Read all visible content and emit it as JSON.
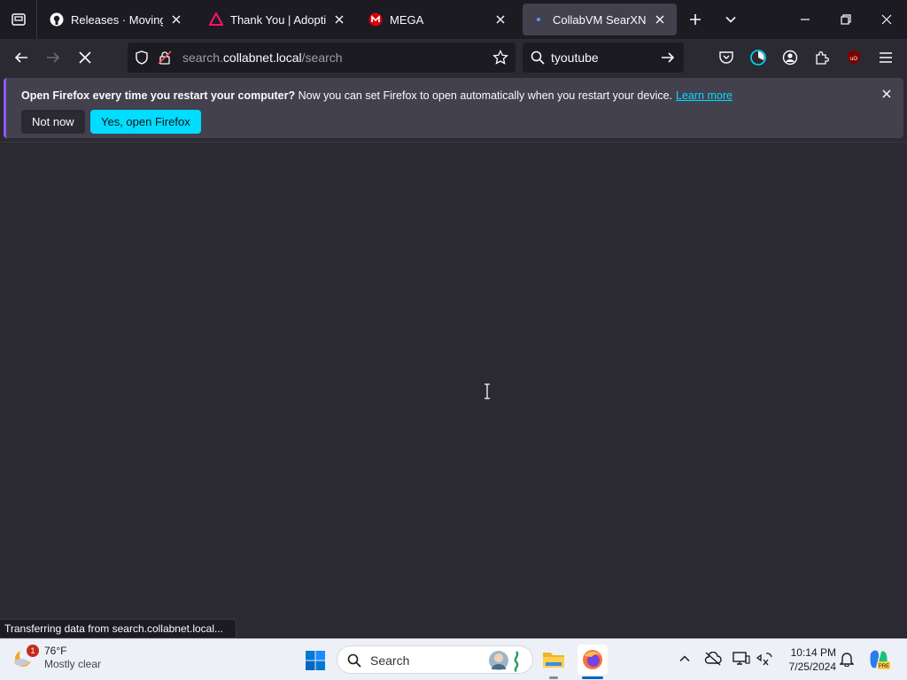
{
  "tabs": [
    {
      "title": "Releases · MovingBlock",
      "icon": "github-icon",
      "selected": false
    },
    {
      "title": "Thank You | Adoptium",
      "icon": "adoptium-icon",
      "selected": false
    },
    {
      "title": "MEGA",
      "icon": "mega-icon",
      "selected": false
    },
    {
      "title": "CollabVM SearXNG",
      "icon": "loading-dot-icon",
      "selected": true
    }
  ],
  "navbar": {
    "url_prefix": "search.",
    "url_host": "collabnet.local",
    "url_path": "/search",
    "search_value": "tyoutube"
  },
  "notification": {
    "bold": "Open Firefox every time you restart your computer?",
    "text": " Now you can set Firefox to open automatically when you restart your device.",
    "link": "Learn more",
    "not_now": "Not now",
    "yes": "Yes, open Firefox"
  },
  "status": "Transferring data from search.collabnet.local...",
  "taskbar": {
    "weather_temp": "76°F",
    "weather_cond": "Mostly clear",
    "weather_badge": "1",
    "search_label": "Search",
    "time": "10:14 PM",
    "date": "7/25/2024"
  },
  "colors": {
    "accent": "#00ddff",
    "tab_selected": "#42414d",
    "frame": "#1c1b22",
    "toolbar": "#2b2a33"
  }
}
